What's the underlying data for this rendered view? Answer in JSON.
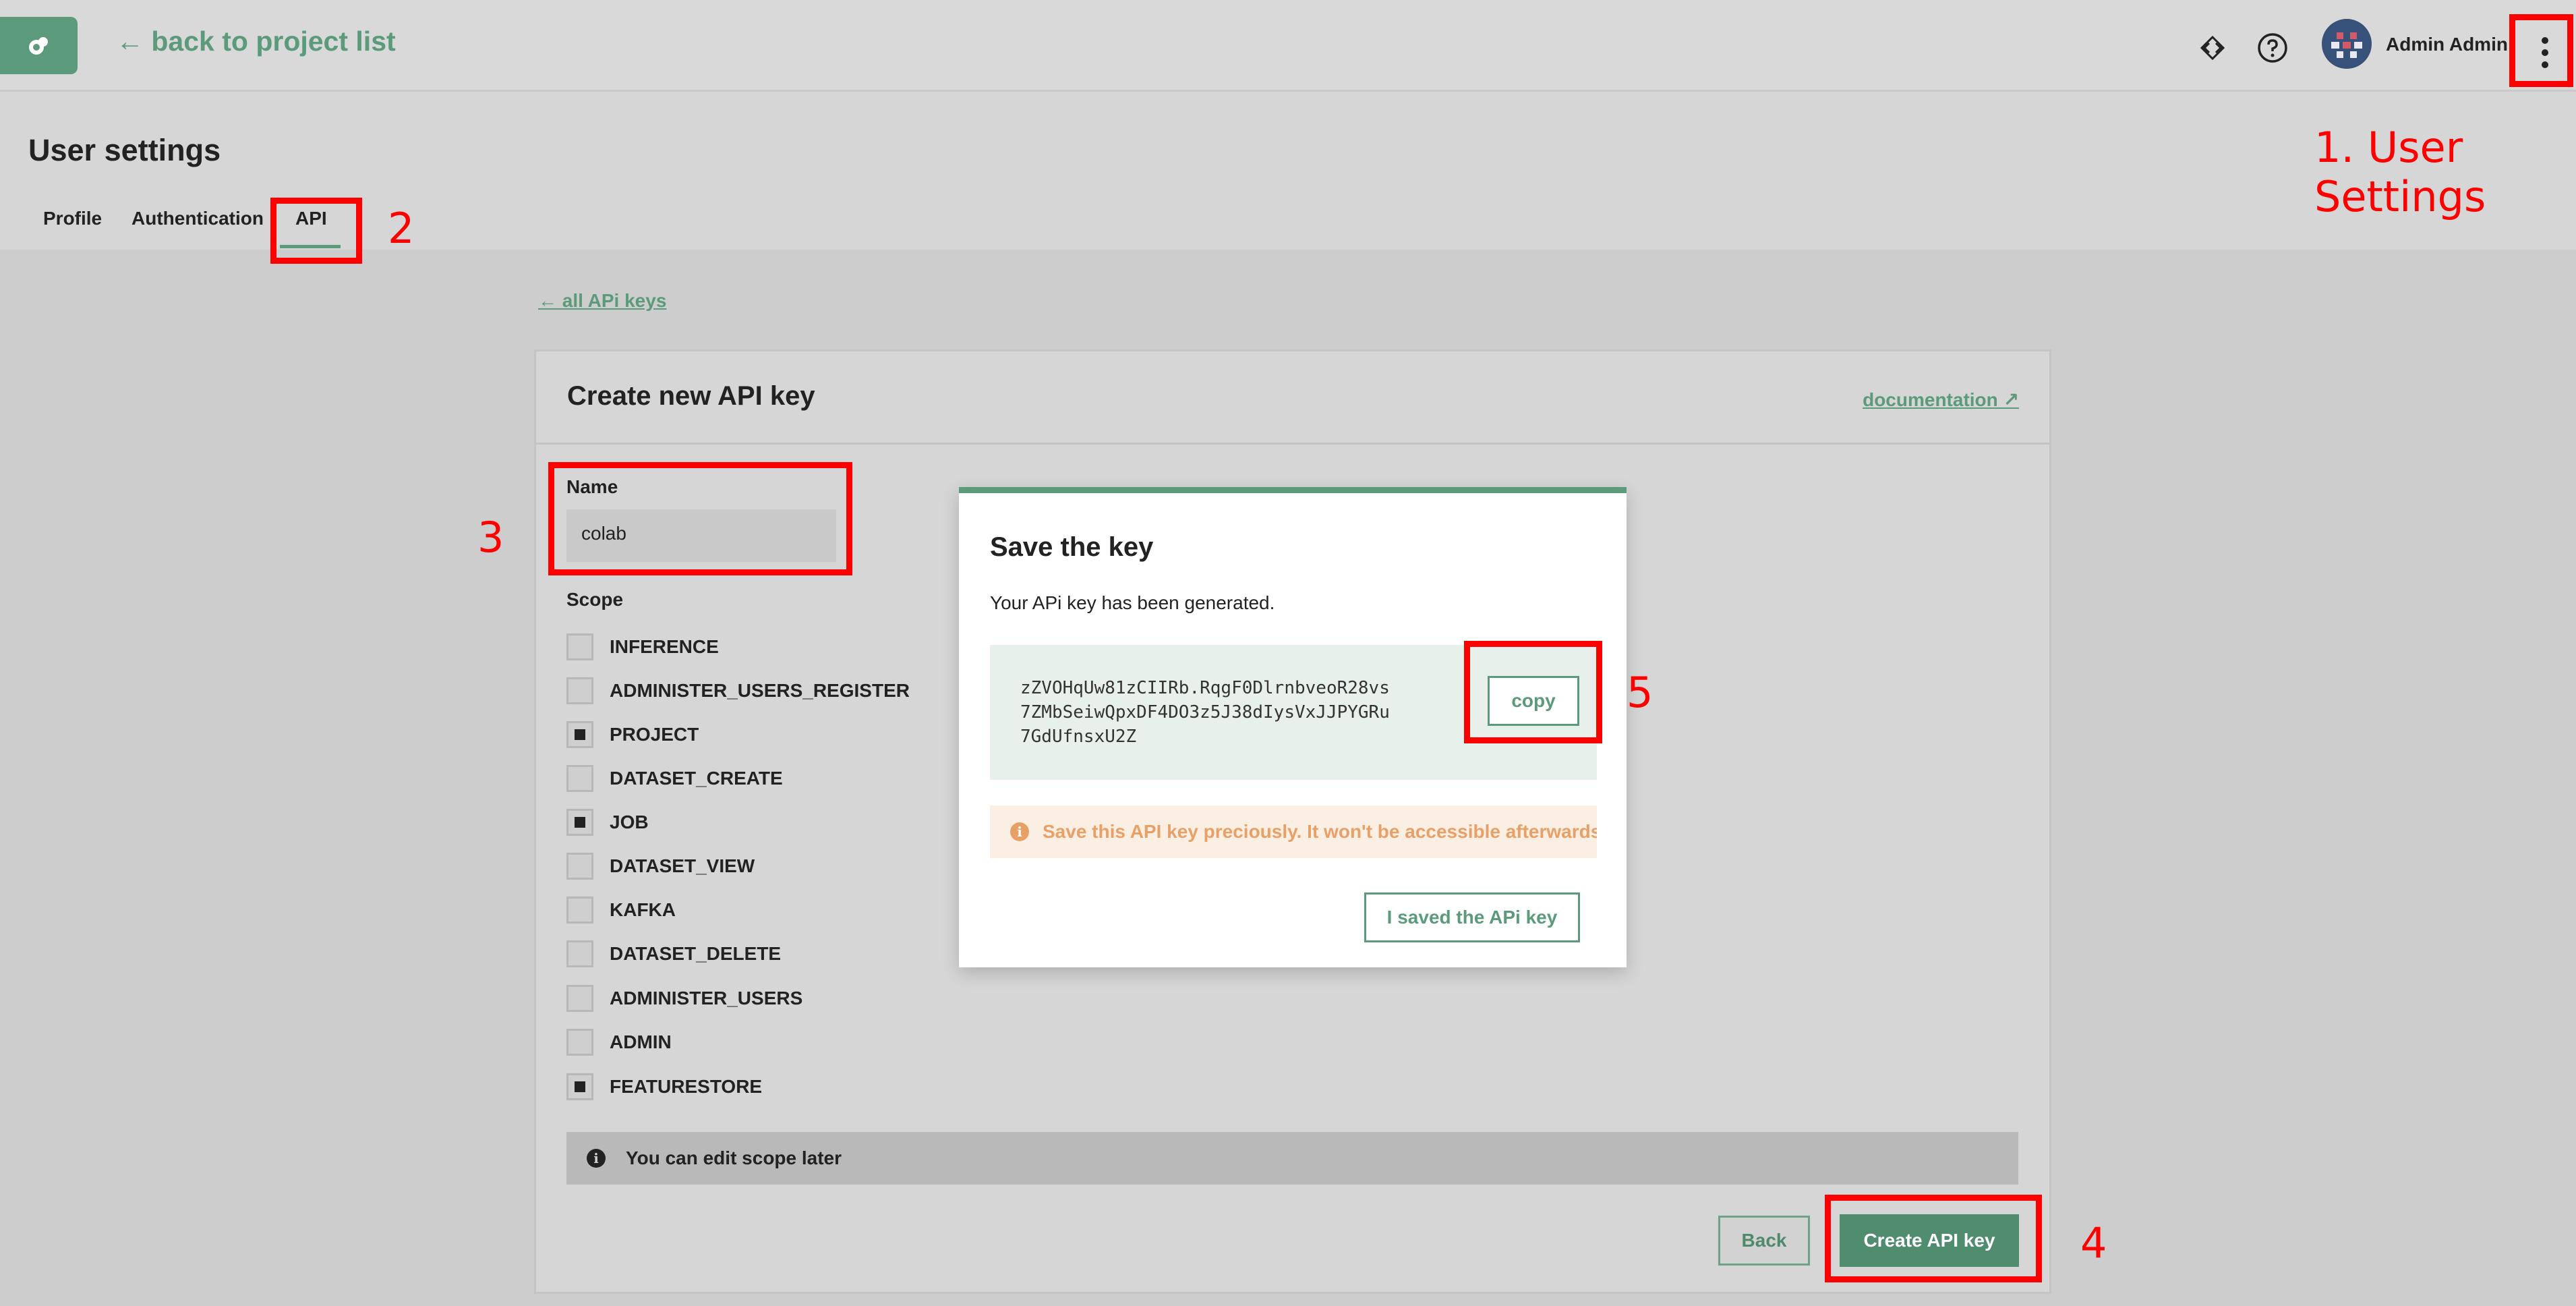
{
  "header": {
    "back_label": "← back to project list",
    "user_name": "Admin Admin",
    "icons": [
      "logo-icon",
      "diff-icon",
      "help-icon",
      "avatar",
      "more-vertical-icon"
    ]
  },
  "page": {
    "title": "User settings",
    "tabs": [
      {
        "label": "Profile"
      },
      {
        "label": "Authentication"
      },
      {
        "label": "API",
        "active": true
      }
    ]
  },
  "annotations": {
    "step1": "1. User\nSettings",
    "step2": "2",
    "step3": "3",
    "step4": "4",
    "step5": "5"
  },
  "api": {
    "back_link": "← all APi keys",
    "card_title": "Create new API key",
    "documentation_link": "documentation ↗",
    "name_label": "Name",
    "name_value": "colab",
    "scope_label": "Scope",
    "scopes": [
      {
        "label": "INFERENCE",
        "checked": false
      },
      {
        "label": "ADMINISTER_USERS_REGISTER",
        "checked": false
      },
      {
        "label": "PROJECT",
        "checked": true
      },
      {
        "label": "DATASET_CREATE",
        "checked": false
      },
      {
        "label": "JOB",
        "checked": true
      },
      {
        "label": "DATASET_VIEW",
        "checked": false
      },
      {
        "label": "KAFKA",
        "checked": false
      },
      {
        "label": "DATASET_DELETE",
        "checked": false
      },
      {
        "label": "ADMINISTER_USERS",
        "checked": false
      },
      {
        "label": "ADMIN",
        "checked": false
      },
      {
        "label": "FEATURESTORE",
        "checked": true
      }
    ],
    "scope_info": "You can edit scope later",
    "back_button": "Back",
    "create_button": "Create API key"
  },
  "modal": {
    "title": "Save the key",
    "message": "Your APi key has been generated.",
    "key": "zZVOHqUw81zCIIRb.RqgF0DlrnbveoR28vs7ZMbSeiwQpxDF4DO3z5J38dIysVxJJPYGRu7GdUfnsxU2Z",
    "copy_button": "copy",
    "warning": "Save this API key preciously. It won't be accessible afterwards",
    "saved_button": "I saved the APi key"
  },
  "colors": {
    "accent": "#5b9a7a",
    "annotation": "#ff0000",
    "warning": "#e8a067"
  }
}
